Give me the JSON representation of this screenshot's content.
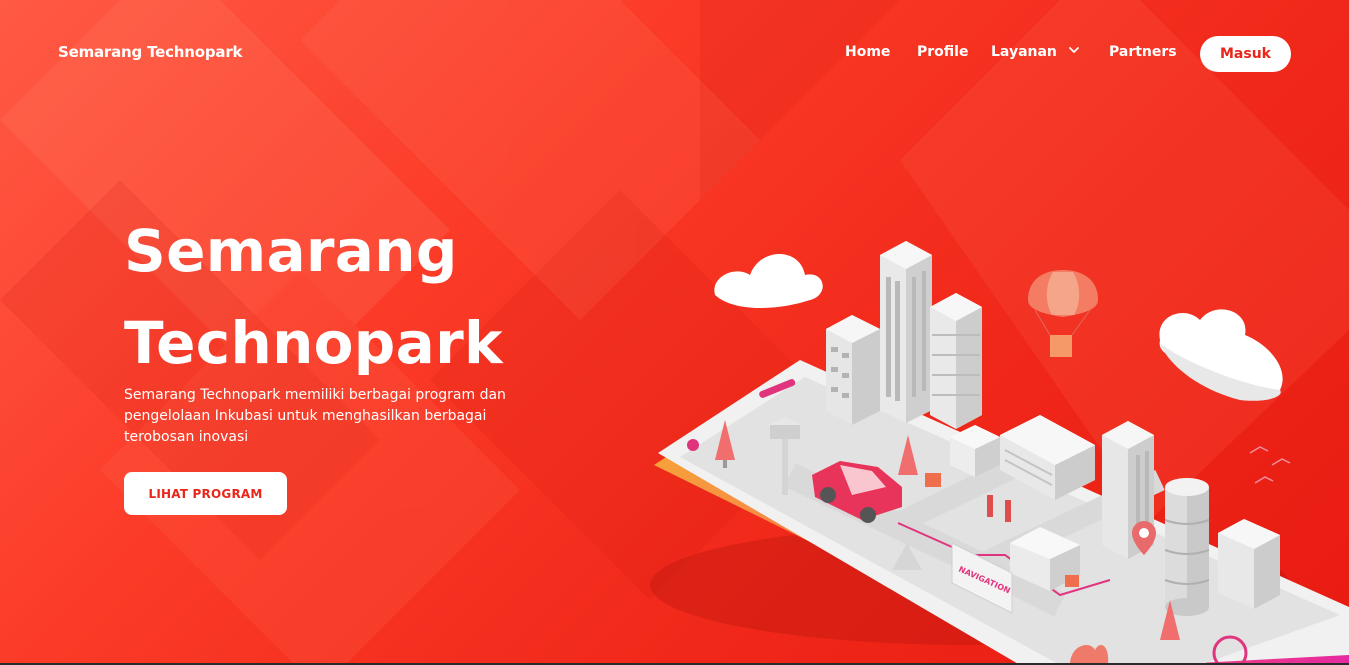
{
  "brand": {
    "name": "Semarang Technopark"
  },
  "nav": {
    "items": [
      {
        "label": "Home"
      },
      {
        "label": "Profile"
      },
      {
        "label": "Layanan",
        "icon": "chevron-down-icon"
      },
      {
        "label": "Partners"
      }
    ],
    "login_label": "Masuk"
  },
  "hero": {
    "title_line1": "Semarang",
    "title_line2": "Technopark",
    "description": "Semarang Technopark memiliki berbagai program dan pengelolaan Inkubasi untuk menghasilkan berbagai terobosan inovasi",
    "cta_label": "LIHAT PROGRAM"
  },
  "illustration": {
    "sign_text": "NAVIGATION"
  },
  "colors": {
    "accent": "#e8261a",
    "background_start": "#ff5a44",
    "background_end": "#e81b12",
    "text_on_accent": "#ffffff"
  }
}
